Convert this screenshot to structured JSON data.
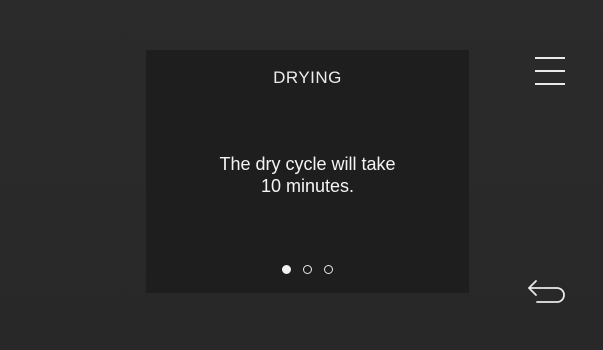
{
  "panel": {
    "title": "DRYING",
    "message_lines": [
      "The dry cycle will take",
      "10 minutes."
    ]
  },
  "pagination": {
    "total": 3,
    "active_index": 0
  },
  "icons": {
    "menu": "menu-icon",
    "back": "back-arrow-icon"
  },
  "colors": {
    "background": "#2a2a2a",
    "panel": "#1e1e1e",
    "foreground": "#f2f2f2"
  }
}
